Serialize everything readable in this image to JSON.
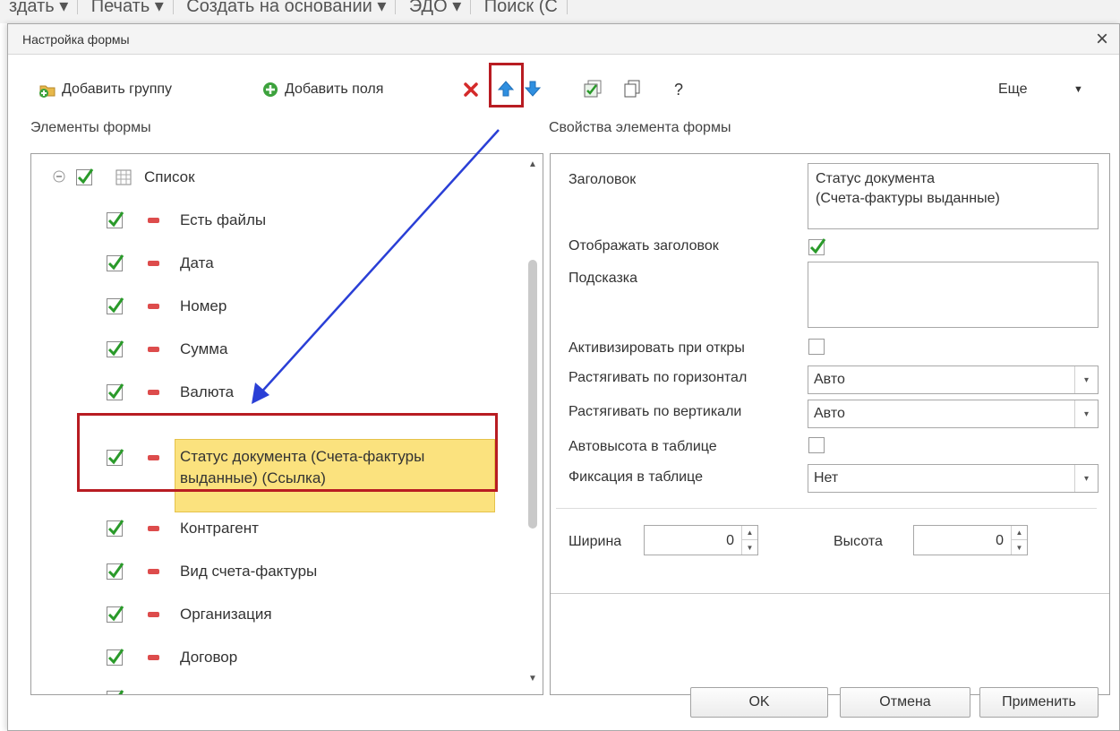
{
  "background_toolbar": [
    "здать ▾",
    "Печать ▾",
    "Создать на основании ▾",
    "ЭДО ▾",
    "Поиск (С"
  ],
  "dialog": {
    "title": "Настройка формы",
    "close_glyph": "×"
  },
  "toolbar": {
    "add_group": "Добавить группу",
    "add_fields": "Добавить поля",
    "help": "?",
    "more": "Еще",
    "more_arrow": "▼"
  },
  "left_panel": {
    "title": "Элементы формы",
    "root": "Список",
    "items": [
      "Есть файлы",
      "Дата",
      "Номер",
      "Сумма",
      "Валюта",
      "Статус документа (Счета-фактуры выданные) (Ссылка)",
      "Контрагент",
      "Вид счета-фактуры",
      "Организация",
      "Договор"
    ],
    "selected_line1": "Статус документа (Счета-фактуры",
    "selected_line2": "выданные) (Ссылка)"
  },
  "right_panel": {
    "title": "Свойства элемента формы",
    "header_label": "Заголовок",
    "header_value_line1": "Статус документа",
    "header_value_line2": "(Счета-фактуры выданные)",
    "show_header_label": "Отображать заголовок",
    "show_header_checked": true,
    "tooltip_label": "Подсказка",
    "tooltip_value": "",
    "activate_label": "Активизировать при откры",
    "activate_checked": false,
    "stretch_h_label": "Растягивать по горизонтал",
    "stretch_h_value": "Авто",
    "stretch_v_label": "Растягивать по вертикали",
    "stretch_v_value": "Авто",
    "autoheight_label": "Автовысота в таблице",
    "autoheight_checked": false,
    "fix_label": "Фиксация в таблице",
    "fix_value": "Нет",
    "width_label": "Ширина",
    "width_value": "0",
    "height_label": "Высота",
    "height_value": "0"
  },
  "footer": {
    "ok": "OK",
    "cancel": "Отмена",
    "apply": "Применить"
  },
  "colors": {
    "highlight_red": "#b81c22",
    "selection_yellow": "#fbe27e",
    "arrow_blue": "#2a3fd6",
    "check_green": "#2a9a2a",
    "minus_red": "#dd4c4c"
  }
}
